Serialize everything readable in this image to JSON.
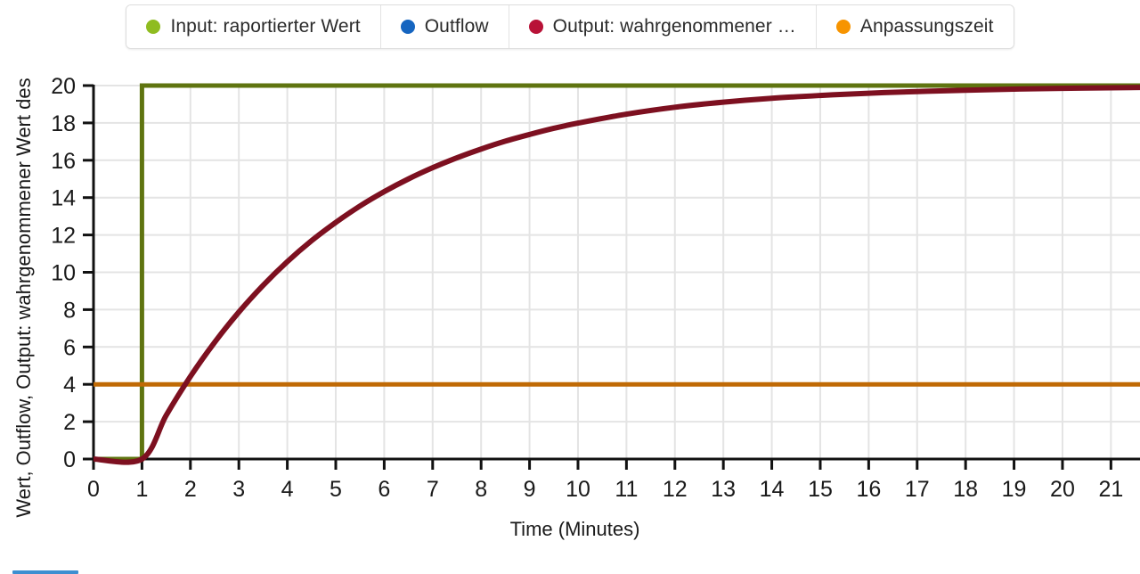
{
  "legend": {
    "items": [
      {
        "label": "Input: raportierter Wert",
        "color": "#8fbc20",
        "name": "legend-item-input"
      },
      {
        "label": "Outflow",
        "color": "#1565c0",
        "name": "legend-item-outflow"
      },
      {
        "label": "Output: wahrgenommener …",
        "color": "#b81237",
        "name": "legend-item-output"
      },
      {
        "label": "Anpassungszeit",
        "color": "#f79400",
        "name": "legend-item-anpassungszeit"
      }
    ]
  },
  "chart_data": {
    "type": "line",
    "title": "",
    "xlabel": "Time (Minutes)",
    "ylabel": "Wert, Outflow, Output: wahrgenommener Wert des",
    "xlim": [
      0,
      21.6
    ],
    "ylim": [
      0,
      20
    ],
    "xticks": [
      0,
      1,
      2,
      3,
      4,
      5,
      6,
      7,
      8,
      9,
      10,
      11,
      12,
      13,
      14,
      15,
      16,
      17,
      18,
      19,
      20,
      21
    ],
    "yticks": [
      0,
      2,
      4,
      6,
      8,
      10,
      12,
      14,
      16,
      18,
      20
    ],
    "grid": true,
    "legend_position": "top-center",
    "series": [
      {
        "name": "Input: raportierter Wert",
        "color": "#5f7410",
        "type": "step",
        "x": [
          0,
          1,
          1,
          21.6
        ],
        "values": [
          0,
          0,
          20,
          20
        ]
      },
      {
        "name": "Outflow",
        "color": "#1565c0",
        "type": "line",
        "note": "hidden behind Output curve",
        "x": [],
        "values": []
      },
      {
        "name": "Output: wahrgenommener Wert des",
        "color": "#7d1020",
        "type": "line",
        "x": [
          0,
          1,
          1.5,
          2,
          2.5,
          3,
          3.5,
          4,
          4.5,
          5,
          5.5,
          6,
          6.5,
          7,
          7.5,
          8,
          8.5,
          9,
          9.5,
          10,
          11,
          12,
          13,
          14,
          15,
          16,
          17,
          18,
          19,
          20,
          21,
          21.6
        ],
        "values": [
          0,
          0,
          2.34,
          4.42,
          6.25,
          7.87,
          9.3,
          10.57,
          11.69,
          12.67,
          13.55,
          14.32,
          15.0,
          15.6,
          16.13,
          16.6,
          17.02,
          17.38,
          17.71,
          17.99,
          18.47,
          18.84,
          19.11,
          19.32,
          19.47,
          19.59,
          19.68,
          19.75,
          19.81,
          19.85,
          19.88,
          19.9
        ]
      },
      {
        "name": "Anpassungszeit",
        "color": "#c06a05",
        "type": "line",
        "x": [
          0,
          21.6
        ],
        "values": [
          4,
          4
        ]
      }
    ]
  },
  "colors": {
    "grid": "#e4e4e4",
    "axis": "#111111",
    "background": "#ffffff",
    "accent_bottom": "#3d8fd1"
  }
}
